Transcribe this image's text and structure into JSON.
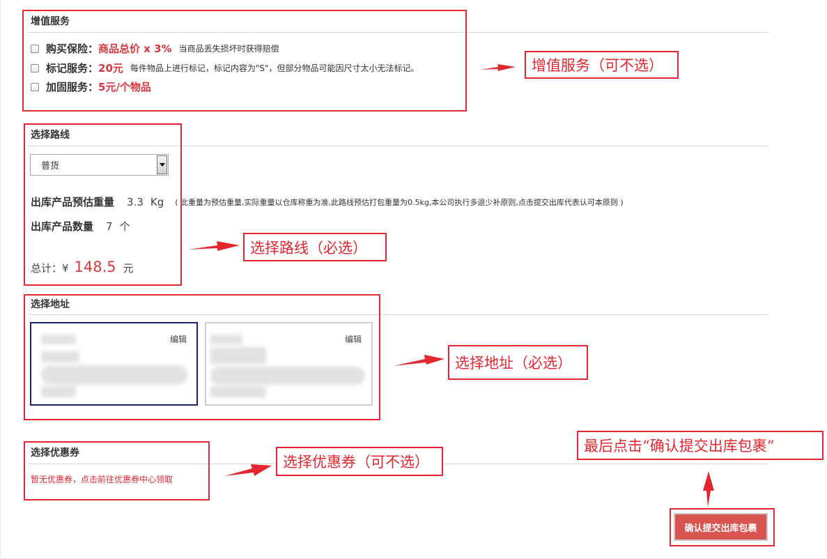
{
  "value_added": {
    "title": "增值服务",
    "services": [
      {
        "label": "购买保险：",
        "value": "商品总价 x 3%",
        "desc": "当商品丢失损坏时获得赔偿",
        "checked": false
      },
      {
        "label": "标记服务：",
        "value": "20元",
        "desc": "每件物品上进行标记，标记内容为\"S\"，但部分物品可能因尺寸太小无法标记。",
        "checked": false
      },
      {
        "label": "加固服务：",
        "value": "5元/个物品",
        "desc": "",
        "checked": false
      }
    ]
  },
  "route": {
    "title": "选择路线",
    "selected": "普货",
    "weight_label": "出库产品预估重量",
    "weight_value": "3.3",
    "weight_unit": "Kg",
    "weight_note": "( 此重量为预估重量,实际重量以仓库称重为准,此路线预估打包重量为0.5kg,本公司执行多退少补原则,点击提交出库代表认可本原则 )",
    "qty_label": "出库产品数量",
    "qty_value": "7",
    "qty_unit": "个",
    "total_prefix": "总计：¥",
    "total_value": "148.5",
    "total_suffix": "元"
  },
  "address": {
    "title": "选择地址",
    "cards": [
      {
        "edit_label": "编辑",
        "selected": true
      },
      {
        "edit_label": "编辑",
        "selected": false
      }
    ]
  },
  "coupon": {
    "title": "选择优惠券",
    "message": "暂无优惠券，点击前往优惠券中心领取"
  },
  "submit_label": "确认提交出库包裹",
  "annotations": {
    "value_added": "增值服务（可不选）",
    "route": "选择路线（必选）",
    "address": "选择地址（必选）",
    "coupon": "选择优惠券（可不选）",
    "submit": "最后点击“确认提交出库包裹”"
  },
  "colors": {
    "annotation_red": "#e3262f",
    "price_red": "#d9363e",
    "button_red": "#d9534f",
    "selected_card_border": "#1a1f6e"
  }
}
